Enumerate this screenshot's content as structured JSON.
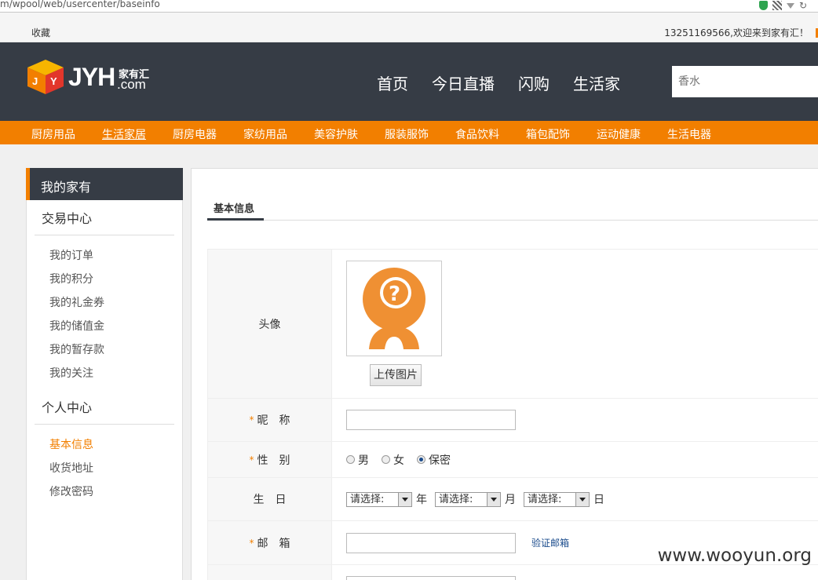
{
  "browser": {
    "url": "m/wpool/web/usercenter/baseinfo"
  },
  "topbar": {
    "favorites": "收藏",
    "welcome": "13251169566,欢迎来到家有汇！"
  },
  "header": {
    "logo_text": "JYH",
    "logo_cn": "家有汇",
    "logo_domain": ".com",
    "nav": [
      "首页",
      "今日直播",
      "闪购",
      "生活家"
    ],
    "search_placeholder": "香水"
  },
  "categories": [
    "厨房用品",
    "生活家居",
    "厨房电器",
    "家纺用品",
    "美容护肤",
    "服装服饰",
    "食品饮料",
    "箱包配饰",
    "运动健康",
    "生活电器"
  ],
  "active_category": "生活家居",
  "sidebar": {
    "title": "我的家有",
    "trade_center": "交易中心",
    "trade_items": [
      "我的订单",
      "我的积分",
      "我的礼金券",
      "我的储值金",
      "我的暂存款",
      "我的关注"
    ],
    "personal_center": "个人中心",
    "personal_items": [
      "基本信息",
      "收货地址",
      "修改密码"
    ]
  },
  "content": {
    "tab": "基本信息",
    "avatar_label": "头像",
    "upload_button": "上传图片",
    "nickname_label": "昵　称",
    "gender_label": "性　别",
    "gender_options": [
      "男",
      "女",
      "保密"
    ],
    "gender_selected": "保密",
    "birthday_label": "生　日",
    "birthday_placeholder": "请选择:",
    "year_unit": "年",
    "month_unit": "月",
    "day_unit": "日",
    "email_label": "邮　箱",
    "verify_email": "验证邮箱"
  },
  "watermark": "www.wooyun.org",
  "colors": {
    "accent": "#f27f00",
    "header_bg": "#363c45",
    "link": "#1a4b8c"
  }
}
